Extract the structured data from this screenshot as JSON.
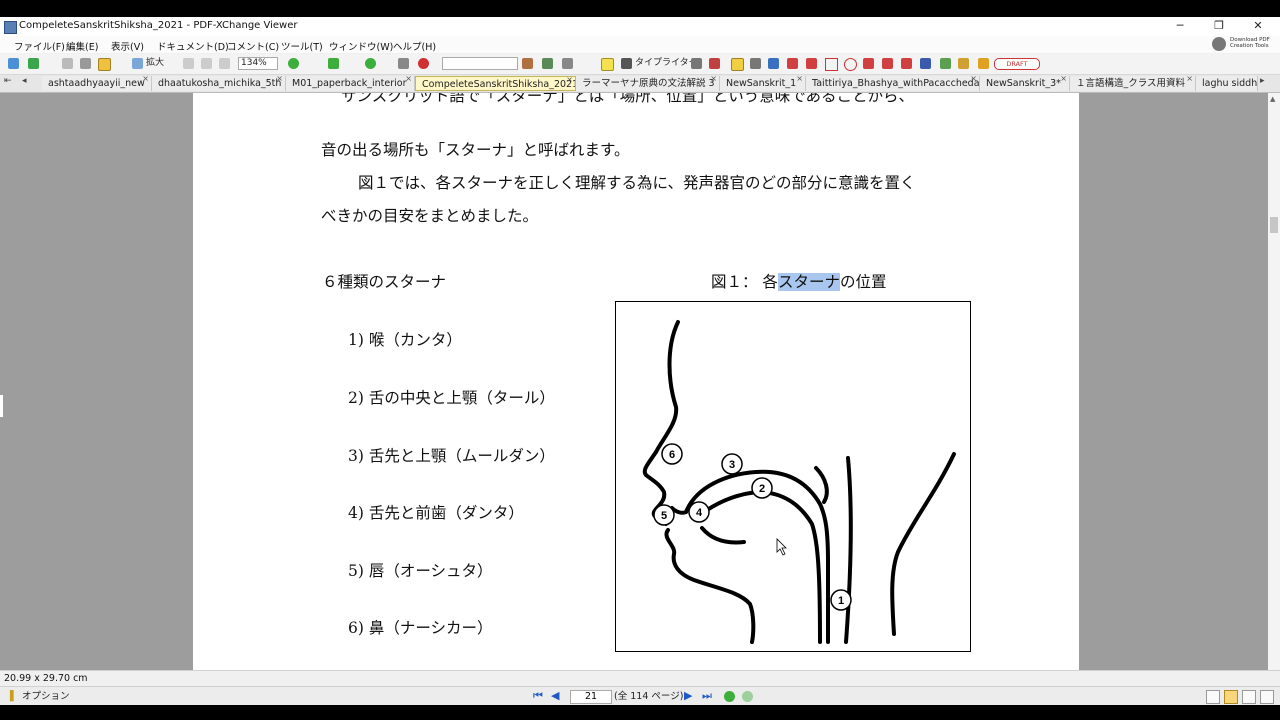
{
  "window": {
    "title": "CompeleteSanskritShiksha_2021 - PDF-XChange Viewer",
    "controls": [
      "─",
      "❐",
      "✕"
    ]
  },
  "menu": [
    "ファイル(F)",
    "編集(E)",
    "表示(V)",
    "ドキュメント(D)",
    "コメント(C)",
    "ツール(T)",
    "ウィンドウ(W)",
    "ヘルプ(H)"
  ],
  "download_pdf": "Download PDF Creation Tools",
  "toolbar": {
    "zoom_in_label": "拡大",
    "zoom_value": "134%",
    "typewriter_label": "タイプライター",
    "draft_stamp": "DRAFT"
  },
  "tabs": [
    "ashtaadhyaayii_new",
    "dhaatukosha_michika_5th",
    "M01_paperback_interior",
    "CompeleteSanskritShiksha_2021",
    "ラーマーヤナ原典の文法解説 3",
    "NewSanskrit_1",
    "Taittiriya_Bhashya_withPacaccheda",
    "NewSanskrit_3*",
    "１言語構造_クラス用資料",
    "laghu siddh"
  ],
  "document": {
    "line1_pre": "サンスクリット語で「スターナ」とは「場所、位置」という意味であることから、",
    "line2": "音の出る場所も「スターナ」と呼ばれます。",
    "line3": "図１では、各スターナを正しく理解する為に、発声器官のどの部分に意識を置く",
    "line4": "べきかの目安をまとめました。",
    "list_heading": "６種類のスターナ",
    "fig_caption_pre": "図１： 各",
    "fig_caption_hl": "スターナ",
    "fig_caption_post": "の位置",
    "items": [
      "1)  喉（カンタ）",
      "2)  舌の中央と上顎（タール）",
      "3)  舌先と上顎（ムールダン）",
      "4)  舌先と前歯（ダンタ）",
      "5)  唇（オーシュタ）",
      "6)  鼻（ナーシカー）"
    ],
    "figure_markers": [
      "1",
      "2",
      "3",
      "4",
      "5",
      "6"
    ]
  },
  "status": {
    "page_size": "20.99 x 29.70 cm",
    "options_label": "オプション",
    "current_page": "21",
    "total_pages": "(全 114 ページ)"
  },
  "colors": {
    "active_tab": "#fff7c8",
    "selection_highlight": "#a9c6ee",
    "viewer_bg": "#9d9d9d"
  }
}
